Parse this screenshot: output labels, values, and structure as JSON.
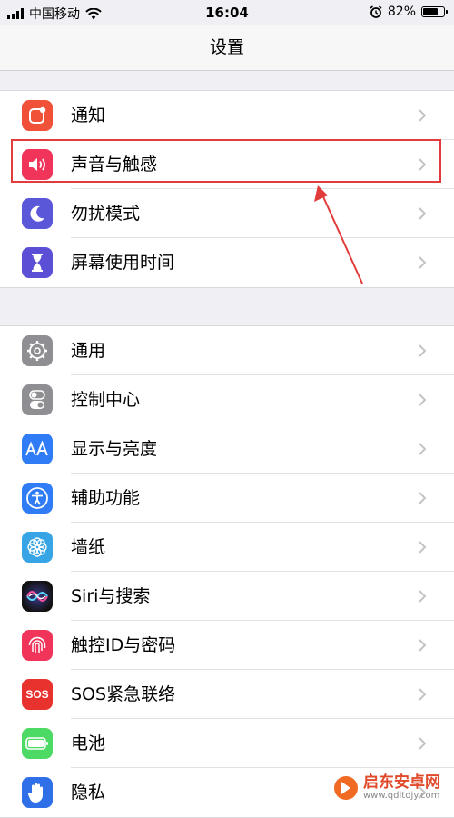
{
  "status_bar": {
    "carrier": "中国移动",
    "time": "16:04",
    "battery_percent": "82%",
    "battery_level": 82
  },
  "nav": {
    "title": "设置"
  },
  "group1": [
    {
      "label": "通知",
      "icon": "notification-icon",
      "color": "#f05138"
    },
    {
      "label": "声音与触感",
      "icon": "speaker-icon",
      "color": "#f0345a"
    },
    {
      "label": "勿扰模式",
      "icon": "moon-icon",
      "color": "#5b57d9"
    },
    {
      "label": "屏幕使用时间",
      "icon": "hourglass-icon",
      "color": "#5b4fd6"
    }
  ],
  "group2": [
    {
      "label": "通用",
      "icon": "gear-icon",
      "color": "#8e8e93"
    },
    {
      "label": "控制中心",
      "icon": "toggle-icon",
      "color": "#8e8e93"
    },
    {
      "label": "显示与亮度",
      "icon": "text-size-icon",
      "color": "#2f7cf6"
    },
    {
      "label": "辅助功能",
      "icon": "accessibility-icon",
      "color": "#2f7cf6"
    },
    {
      "label": "墙纸",
      "icon": "flower-icon",
      "color": "#36a4e5"
    },
    {
      "label": "Siri与搜索",
      "icon": "siri-icon",
      "color": "#222222"
    },
    {
      "label": "触控ID与密码",
      "icon": "fingerprint-icon",
      "color": "#f0345a"
    },
    {
      "label": "SOS紧急联络",
      "icon": "sos-icon",
      "color": "#e8322e"
    },
    {
      "label": "电池",
      "icon": "battery-icon",
      "color": "#4cd964"
    },
    {
      "label": "隐私",
      "icon": "hand-icon",
      "color": "#2f6fe8"
    }
  ],
  "watermark": {
    "title": "启东安卓网",
    "url": "www.qdltdjy.com"
  }
}
